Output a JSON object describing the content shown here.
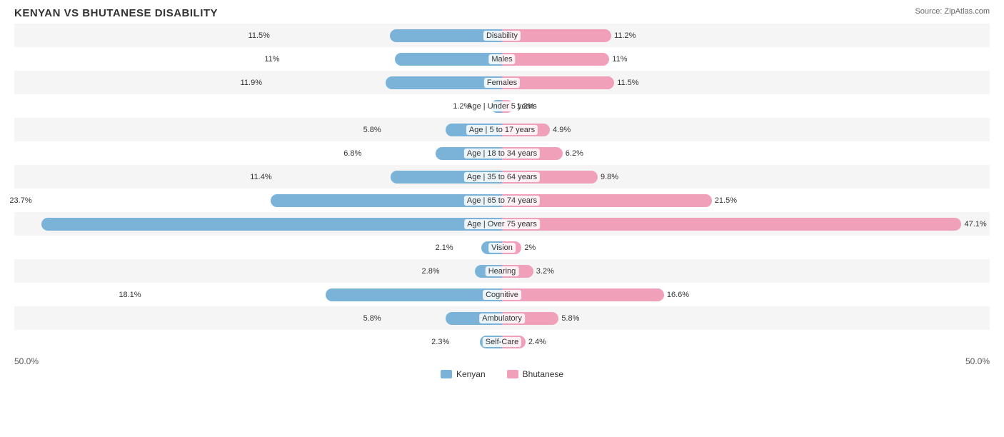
{
  "title": "KENYAN VS BHUTANESE DISABILITY",
  "source": "Source: ZipAtlas.com",
  "chart": {
    "center_pct": 50,
    "scale": 50,
    "rows": [
      {
        "label": "Disability",
        "left_val": 11.5,
        "right_val": 11.2
      },
      {
        "label": "Males",
        "left_val": 11.0,
        "right_val": 11.0
      },
      {
        "label": "Females",
        "left_val": 11.9,
        "right_val": 11.5
      },
      {
        "label": "Age | Under 5 years",
        "left_val": 1.2,
        "right_val": 1.2
      },
      {
        "label": "Age | 5 to 17 years",
        "left_val": 5.8,
        "right_val": 4.9
      },
      {
        "label": "Age | 18 to 34 years",
        "left_val": 6.8,
        "right_val": 6.2
      },
      {
        "label": "Age | 35 to 64 years",
        "left_val": 11.4,
        "right_val": 9.8
      },
      {
        "label": "Age | 65 to 74 years",
        "left_val": 23.7,
        "right_val": 21.5
      },
      {
        "label": "Age | Over 75 years",
        "left_val": 47.2,
        "right_val": 47.1
      },
      {
        "label": "Vision",
        "left_val": 2.1,
        "right_val": 2.0
      },
      {
        "label": "Hearing",
        "left_val": 2.8,
        "right_val": 3.2
      },
      {
        "label": "Cognitive",
        "left_val": 18.1,
        "right_val": 16.6
      },
      {
        "label": "Ambulatory",
        "left_val": 5.8,
        "right_val": 5.8
      },
      {
        "label": "Self-Care",
        "left_val": 2.3,
        "right_val": 2.4
      }
    ]
  },
  "legend": {
    "kenyan_label": "Kenyan",
    "bhutanese_label": "Bhutanese",
    "kenyan_color": "#7bb3d8",
    "bhutanese_color": "#f0a0b8"
  },
  "axis": {
    "left": "50.0%",
    "right": "50.0%"
  }
}
